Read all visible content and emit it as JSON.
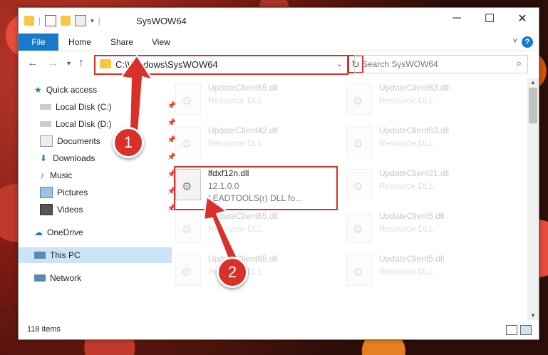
{
  "window": {
    "title": "SysWOW64"
  },
  "ribbon": {
    "tabs": [
      "File",
      "Home",
      "Share",
      "View"
    ],
    "help": "?"
  },
  "address": {
    "path": "C:\\Windows\\SysWOW64"
  },
  "search": {
    "placeholder": "Search SysWOW64"
  },
  "sidebar": {
    "items": [
      {
        "label": "Quick access"
      },
      {
        "label": "Local Disk (C:)"
      },
      {
        "label": "Local Disk (D:)"
      },
      {
        "label": "Documents"
      },
      {
        "label": "Downloads"
      },
      {
        "label": "Music"
      },
      {
        "label": "Pictures"
      },
      {
        "label": "Videos"
      },
      {
        "label": "OneDrive"
      },
      {
        "label": "This PC"
      },
      {
        "label": "Network"
      }
    ]
  },
  "files": {
    "left": [
      {
        "name": "UpdateClient65.dll",
        "desc": "Resource DLL"
      },
      {
        "name": "UpdateClient42.dll",
        "desc": "Resource DLL"
      },
      {
        "name": "lfdxf12n.dll",
        "desc": "12.1.0.0",
        "desc2": "LEADTOOLS(r) DLL fo..."
      },
      {
        "name": "UpdateClient65.dll",
        "desc": "Resource DLL"
      },
      {
        "name": "UpdateClient65.dll",
        "desc": "Resource DLL"
      }
    ],
    "right": [
      {
        "name": "UpdateClient63.dll",
        "desc": "Resource DLL"
      },
      {
        "name": "UpdateClient63.dll",
        "desc": "Resource DLL"
      },
      {
        "name": "UpdateClient21.dll",
        "desc": "Resource DLL"
      },
      {
        "name": "UpdateClient5.dll",
        "desc": "Resource DLL"
      },
      {
        "name": "UpdateClient5.dll",
        "desc": "Resource DLL"
      }
    ]
  },
  "status": {
    "count": "118 items"
  },
  "callouts": {
    "one": "1",
    "two": "2"
  },
  "colors": {
    "accent": "#1979ca",
    "highlight": "#d9302a",
    "selected": "#cce4f7"
  }
}
